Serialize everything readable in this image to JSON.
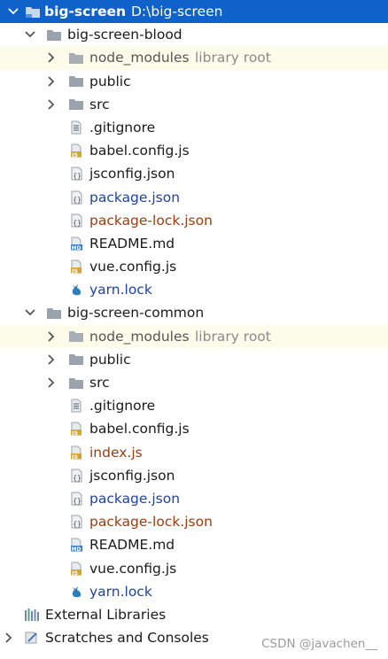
{
  "root": {
    "name": "big-screen",
    "path": "D:\\big-screen"
  },
  "projects": [
    {
      "name": "big-screen-blood",
      "node_modules": {
        "name": "node_modules",
        "hint": "library root"
      },
      "folders": [
        "public",
        "src"
      ],
      "files": [
        {
          "name": ".gitignore",
          "icon": "text-file-icon",
          "color": "default"
        },
        {
          "name": "babel.config.js",
          "icon": "js-file-icon",
          "color": "default"
        },
        {
          "name": "jsconfig.json",
          "icon": "json-file-icon",
          "color": "default"
        },
        {
          "name": "package.json",
          "icon": "json-file-icon",
          "color": "blue"
        },
        {
          "name": "package-lock.json",
          "icon": "json-file-icon",
          "color": "brown"
        },
        {
          "name": "README.md",
          "icon": "markdown-file-icon",
          "color": "default"
        },
        {
          "name": "vue.config.js",
          "icon": "js-file-icon",
          "color": "default"
        },
        {
          "name": "yarn.lock",
          "icon": "yarn-cat-icon",
          "color": "blue"
        }
      ]
    },
    {
      "name": "big-screen-common",
      "node_modules": {
        "name": "node_modules",
        "hint": "library root"
      },
      "folders": [
        "public",
        "src"
      ],
      "files": [
        {
          "name": ".gitignore",
          "icon": "text-file-icon",
          "color": "default"
        },
        {
          "name": "babel.config.js",
          "icon": "js-file-icon",
          "color": "default"
        },
        {
          "name": "index.js",
          "icon": "js-file-icon",
          "color": "brown"
        },
        {
          "name": "jsconfig.json",
          "icon": "json-file-icon",
          "color": "default"
        },
        {
          "name": "package.json",
          "icon": "json-file-icon",
          "color": "blue"
        },
        {
          "name": "package-lock.json",
          "icon": "json-file-icon",
          "color": "brown"
        },
        {
          "name": "README.md",
          "icon": "markdown-file-icon",
          "color": "default"
        },
        {
          "name": "vue.config.js",
          "icon": "js-file-icon",
          "color": "default"
        },
        {
          "name": "yarn.lock",
          "icon": "yarn-cat-icon",
          "color": "blue"
        }
      ]
    }
  ],
  "external_libraries": "External Libraries",
  "scratches": "Scratches and Consoles",
  "watermark": "CSDN @javachen__",
  "colors": {
    "selection": "#0f62c9",
    "library_highlight": "#fdfbe9",
    "modified_blue": "#1e43a5",
    "new_brown": "#9a3d12"
  }
}
